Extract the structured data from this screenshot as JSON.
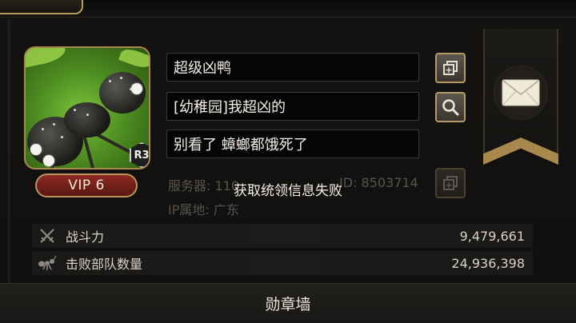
{
  "profile": {
    "name": "超级凶鸭",
    "alliance_line": "[幼稚园]我超凶的",
    "signature": "别看了  蟑螂都饿死了",
    "rank_badge": "R3",
    "vip_label": "VIP 6",
    "server_text": "服务器: 110",
    "id_text": "ID: 8503714",
    "ip_text": "IP属地: 广东"
  },
  "toast": {
    "message": "获取统领信息失败"
  },
  "stats": [
    {
      "label": "战斗力",
      "value": "9,479,661",
      "icon": "crossed-swords-icon"
    },
    {
      "label": "击败部队数量",
      "value": "24,936,398",
      "icon": "ant-icon"
    }
  ],
  "buttons": {
    "copy_name_icon": "copy-icon",
    "search_icon": "magnifier-icon",
    "copy_id_icon": "copy-icon",
    "mail_icon": "envelope-icon"
  },
  "bottom": {
    "medal_wall_label": "勋章墙"
  },
  "colors": {
    "accent_gold": "#b39a67",
    "vip_red": "#8d2a20",
    "background": "#121110"
  }
}
